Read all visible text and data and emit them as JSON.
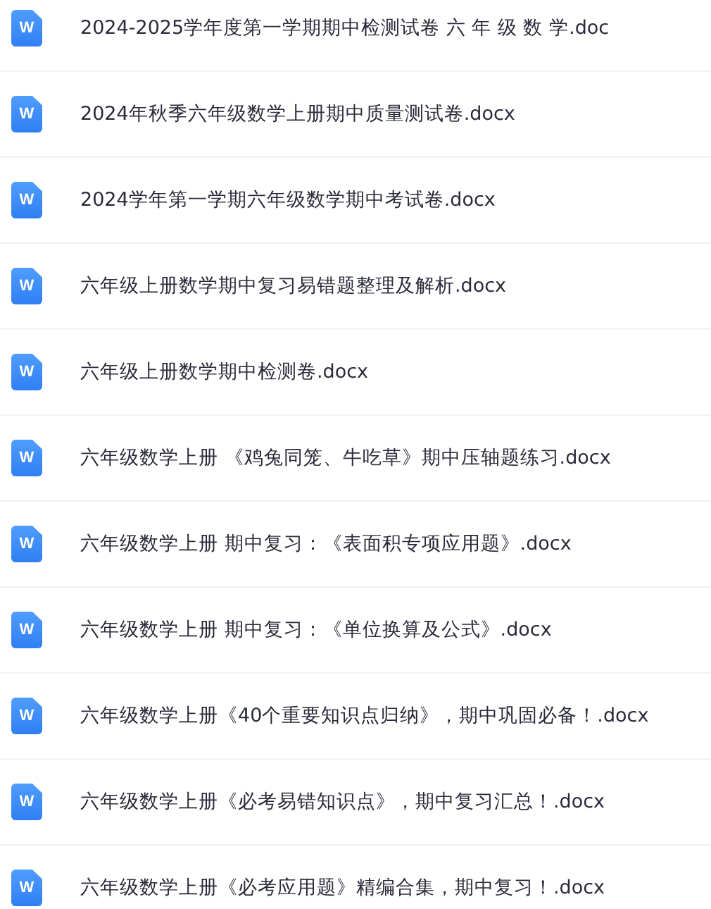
{
  "files": [
    {
      "icon_label": "W",
      "name": "2024-2025学年度第一学期期中检测试卷 六 年 级 数 学.doc"
    },
    {
      "icon_label": "W",
      "name": "2024年秋季六年级数学上册期中质量测试卷.docx"
    },
    {
      "icon_label": "W",
      "name": "2024学年第一学期六年级数学期中考试卷.docx"
    },
    {
      "icon_label": "W",
      "name": "六年级上册数学期中复习易错题整理及解析.docx"
    },
    {
      "icon_label": "W",
      "name": "六年级上册数学期中检测卷.docx"
    },
    {
      "icon_label": "W",
      "name": "六年级数学上册 《鸡兔同笼、牛吃草》期中压轴题练习.docx"
    },
    {
      "icon_label": "W",
      "name": "六年级数学上册 期中复习：《表面积专项应用题》.docx"
    },
    {
      "icon_label": "W",
      "name": "六年级数学上册 期中复习：《单位换算及公式》.docx"
    },
    {
      "icon_label": "W",
      "name": "六年级数学上册《40个重要知识点归纳》，期中巩固必备！.docx"
    },
    {
      "icon_label": "W",
      "name": "六年级数学上册《必考易错知识点》，期中复习汇总！.docx"
    },
    {
      "icon_label": "W",
      "name": "六年级数学上册《必考应用题》精编合集，期中复习！.docx"
    }
  ]
}
